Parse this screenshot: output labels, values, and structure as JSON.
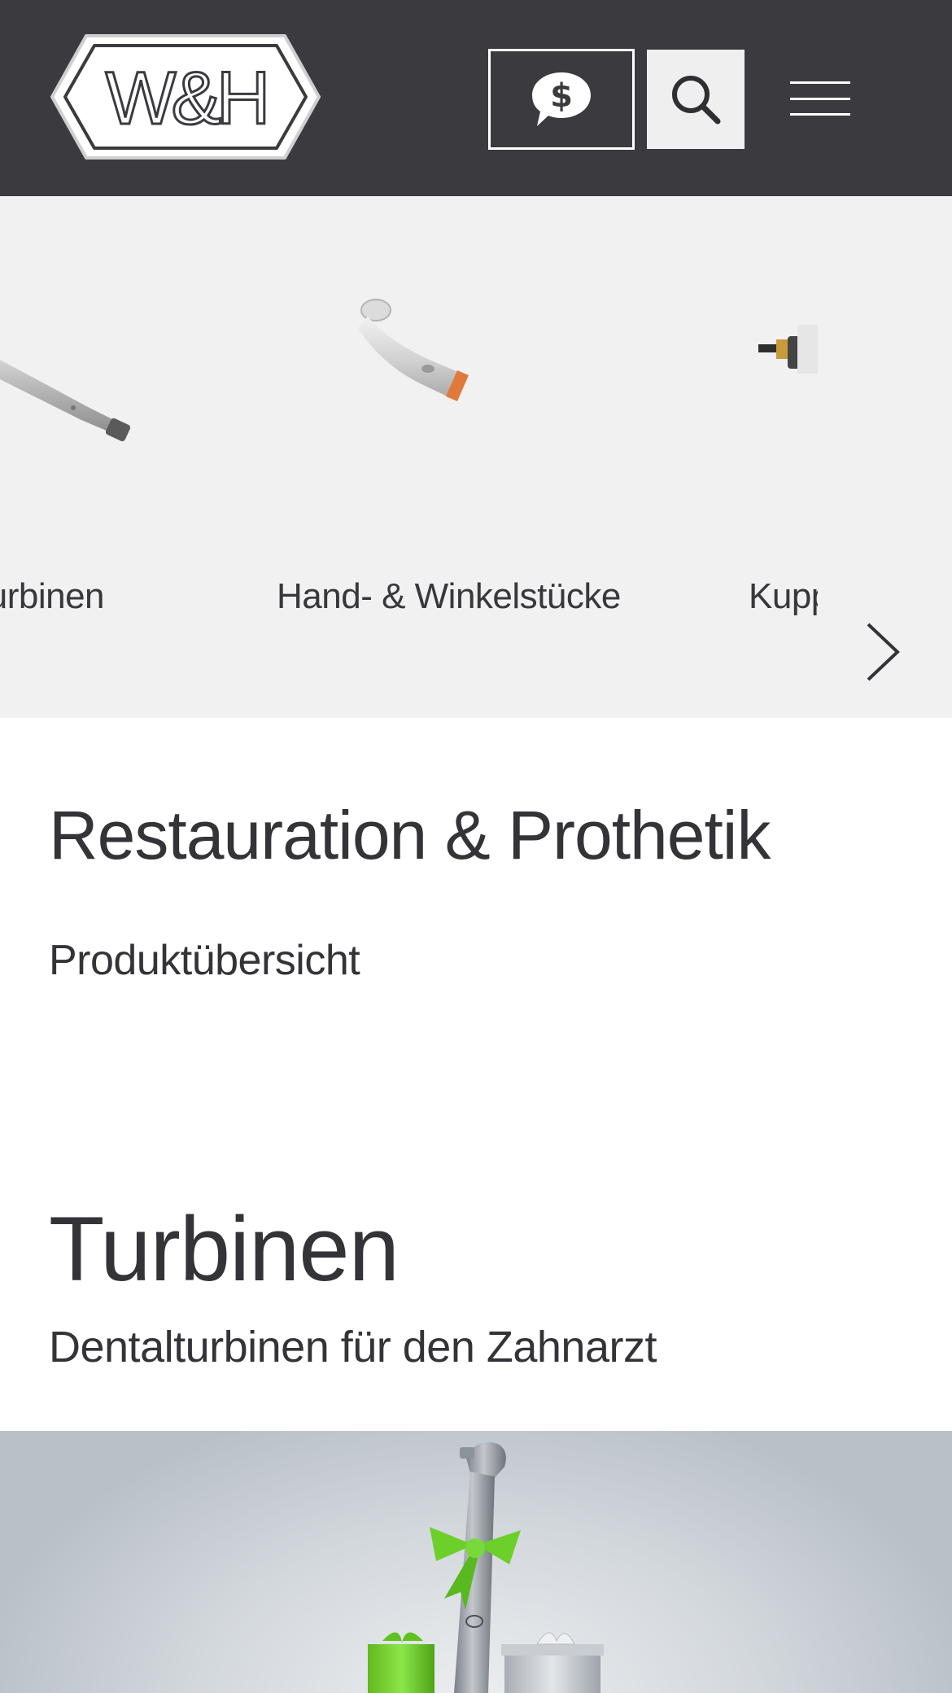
{
  "header": {
    "logo_text": "W&H",
    "quote_button": "dollar-speech-bubble-icon",
    "search_button": "search-icon",
    "menu_button": "hamburger-menu-icon"
  },
  "carousel": {
    "slides": [
      {
        "label": "Turbinen"
      },
      {
        "label": "Hand- & Winkelstücke"
      },
      {
        "label": "Kupplungen"
      }
    ],
    "next_arrow": "chevron-right-icon"
  },
  "restoration": {
    "title": "Restauration & Prothetik",
    "overview_link": "Produktübersicht"
  },
  "turbinen": {
    "title": "Turbinen",
    "subtitle": "Dentalturbinen für den Zahnarzt"
  },
  "colors": {
    "header_bg": "#3b3a3f",
    "carousel_bg": "#f1f1f1",
    "text": "#333338",
    "ribbon_green": "#6ccf2a"
  }
}
